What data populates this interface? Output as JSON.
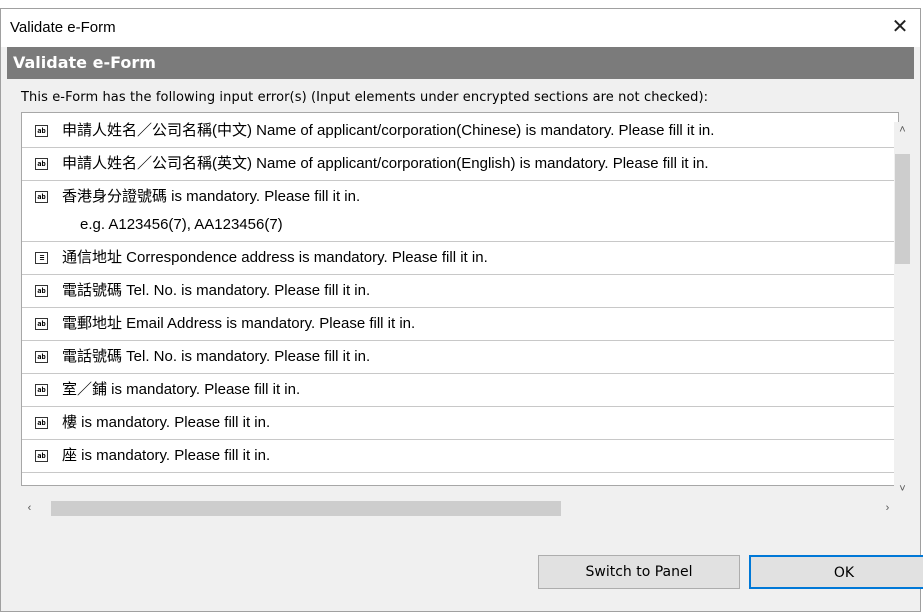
{
  "window": {
    "title": "Validate e-Form",
    "close_glyph": "✕"
  },
  "banner": {
    "title": "Validate e-Form"
  },
  "message": "This e-Form has the following input error(s) (Input elements under encrypted sections are not checked):",
  "errors": [
    {
      "icon": "text-field-icon",
      "icon_text": "ab",
      "text": "申請人姓名／公司名稱(中文) Name of applicant/corporation(Chinese) is mandatory. Please fill it in."
    },
    {
      "icon": "text-field-icon",
      "icon_text": "ab",
      "text": "申請人姓名／公司名稱(英文) Name of applicant/corporation(English) is mandatory. Please fill it in."
    },
    {
      "icon": "text-field-icon",
      "icon_text": "ab",
      "text": "香港身分證號碼 is mandatory. Please fill it in.",
      "hint": "e.g. A123456(7), AA123456(7)"
    },
    {
      "icon": "address-field-icon",
      "icon_text": "≡",
      "text": "通信地址 Correspondence address is mandatory. Please fill it in."
    },
    {
      "icon": "text-field-icon",
      "icon_text": "ab",
      "text": "電話號碼 Tel. No. is mandatory. Please fill it in."
    },
    {
      "icon": "text-field-icon",
      "icon_text": "ab",
      "text": "電郵地址 Email Address is mandatory. Please fill it in."
    },
    {
      "icon": "text-field-icon",
      "icon_text": "ab",
      "text": "電話號碼 Tel. No. is mandatory. Please fill it in."
    },
    {
      "icon": "text-field-icon",
      "icon_text": "ab",
      "text": "室／鋪 is mandatory. Please fill it in."
    },
    {
      "icon": "text-field-icon",
      "icon_text": "ab",
      "text": "樓 is mandatory. Please fill it in."
    },
    {
      "icon": "text-field-icon",
      "icon_text": "ab",
      "text": "座 is mandatory. Please fill it in."
    }
  ],
  "scrollbars": {
    "up_glyph": "˄",
    "down_glyph": "˅",
    "left_glyph": "‹",
    "right_glyph": "›"
  },
  "buttons": {
    "switch_label": "Switch to Panel",
    "ok_label": "OK"
  },
  "colors": {
    "banner_bg": "#7b7b7b",
    "default_button_border": "#0078d7",
    "dialog_bg": "#f0f0f0"
  }
}
